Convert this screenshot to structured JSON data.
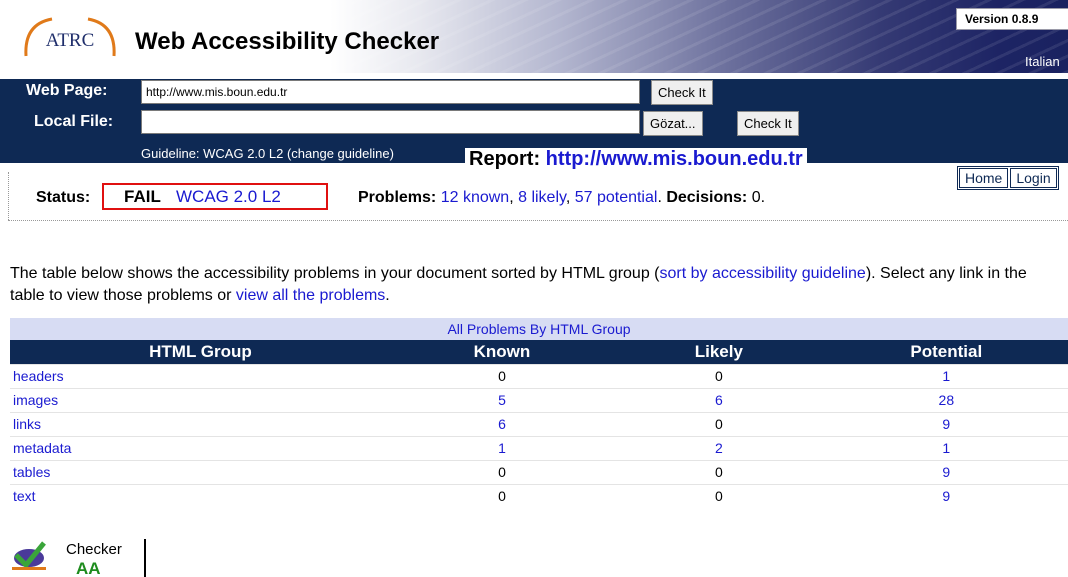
{
  "header": {
    "logo_text": "ATRC",
    "title": "Web Accessibility Checker",
    "version": "Version 0.8.9",
    "language_link": "Italian"
  },
  "form": {
    "web_page_label": "Web Page:",
    "web_page_value": "http://www.mis.boun.edu.tr",
    "check_it_label": "Check It",
    "local_file_label": "Local File:",
    "local_file_value": "",
    "browse_label": "Gözat...",
    "check_it_file_label": "Check It",
    "guideline_prefix": "Guideline: WCAG 2.0 L2 (",
    "change_guideline_label": "change guideline",
    "guideline_suffix": ")"
  },
  "report": {
    "label": "Report:",
    "url": "http://www.mis.boun.edu.tr"
  },
  "nav": {
    "home": "Home",
    "login": "Login"
  },
  "status": {
    "label": "Status:",
    "result": "FAIL",
    "guideline": "WCAG 2.0 L2",
    "problems_label": "Problems:",
    "known": "12 known",
    "likely": "8 likely",
    "potential": "57 potential",
    "decisions_label": "Decisions:",
    "decisions_value": "0."
  },
  "intro": {
    "text_1": "The table below shows the accessibility problems in your document sorted by HTML group (",
    "sort_link": "sort by accessibility guideline",
    "text_2": "). Select any link in the table to view those problems or ",
    "view_all_link": "view all the problems",
    "text_3": "."
  },
  "table": {
    "caption": "All Problems By HTML Group",
    "headers": [
      "HTML Group",
      "Known",
      "Likely",
      "Potential"
    ],
    "rows": [
      {
        "group": "headers",
        "known": "0",
        "likely": "0",
        "potential": "1"
      },
      {
        "group": "images",
        "known": "5",
        "likely": "6",
        "potential": "28"
      },
      {
        "group": "links",
        "known": "6",
        "likely": "0",
        "potential": "9"
      },
      {
        "group": "metadata",
        "known": "1",
        "likely": "2",
        "potential": "1"
      },
      {
        "group": "tables",
        "known": "0",
        "likely": "0",
        "potential": "9"
      },
      {
        "group": "text",
        "known": "0",
        "likely": "0",
        "potential": "9"
      }
    ]
  },
  "badge": {
    "line1": "Checker",
    "line2": "AA"
  },
  "colors": {
    "navy": "#0e2954",
    "link": "#1a1ad0",
    "fail_border": "#e01010",
    "caption_bg": "#d7dcf3"
  }
}
